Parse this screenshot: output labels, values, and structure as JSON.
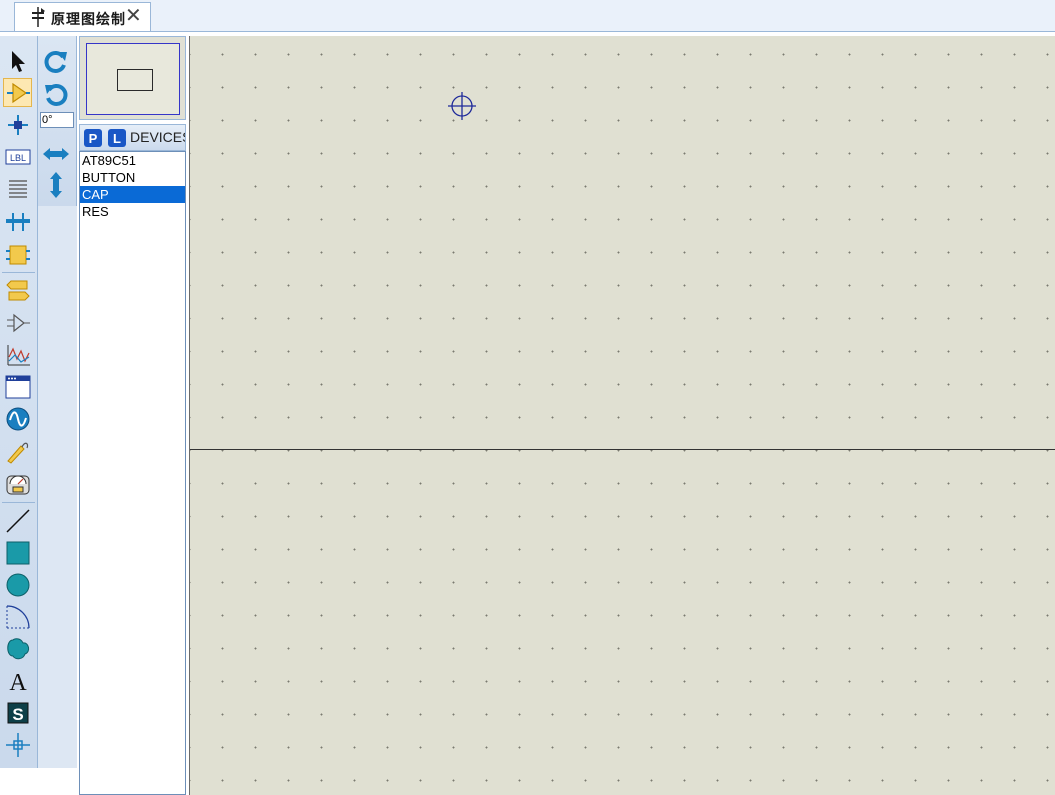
{
  "tab": {
    "title": "原理图绘制",
    "close": "✕"
  },
  "toolbar": {
    "angle_value": "0°",
    "lbl_text": "LBL"
  },
  "device_panel": {
    "p_button": "P",
    "l_button": "L",
    "title": "DEVICES",
    "items": [
      {
        "label": "AT89C51",
        "selected": false
      },
      {
        "label": "BUTTON",
        "selected": false
      },
      {
        "label": "CAP",
        "selected": true
      },
      {
        "label": "RES",
        "selected": false
      }
    ]
  },
  "colors": {
    "accent": "#0a6ad6",
    "canvas": "#e0e0d2",
    "toolbar": "#d3e0f0",
    "icon_blue": "#1a7fc0",
    "icon_teal": "#1a9aa8"
  }
}
